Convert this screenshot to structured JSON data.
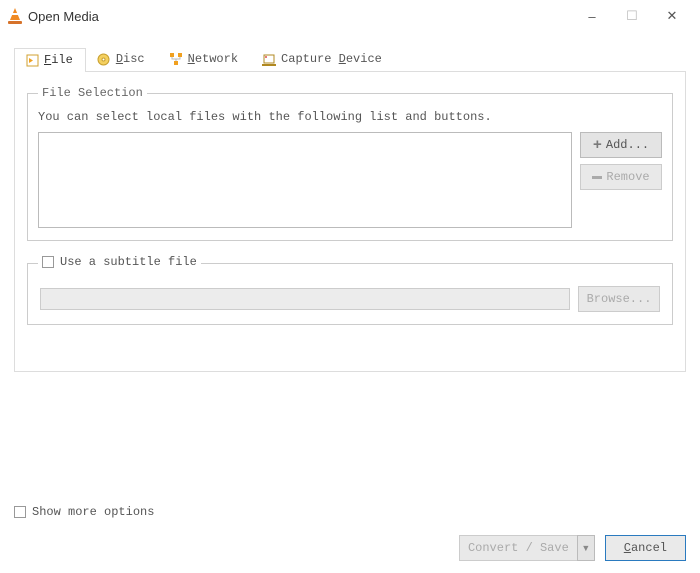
{
  "window": {
    "title": "Open Media",
    "minimize": "–",
    "maximize": "☐",
    "close": "✕"
  },
  "tabs": {
    "file": "File",
    "disc": "Disc",
    "network": "Network",
    "capture": "Capture Device"
  },
  "file_section": {
    "legend": "File Selection",
    "help": "You can select local files with the following list and buttons.",
    "add": "Add...",
    "remove": "Remove"
  },
  "subtitle_section": {
    "checkbox_label": "Use a subtitle file",
    "browse": "Browse..."
  },
  "footer": {
    "show_more": "Show more options",
    "convert_save": "Convert / Save",
    "cancel": "Cancel"
  }
}
